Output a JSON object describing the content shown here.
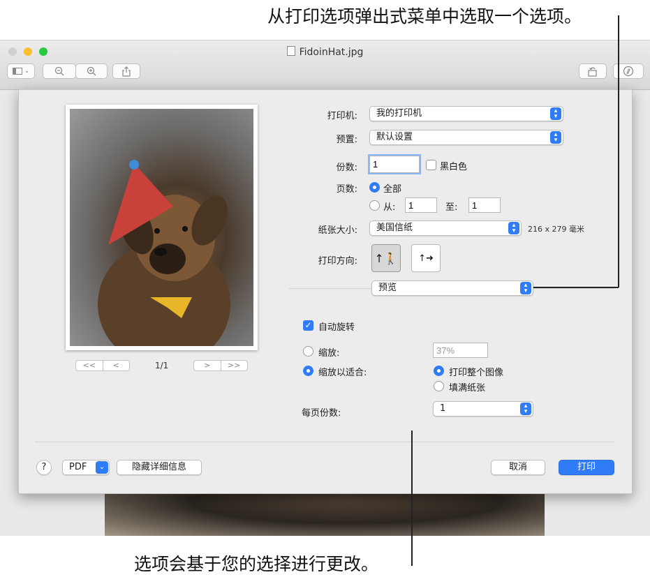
{
  "callouts": {
    "top": "从打印选项弹出式菜单中选取一个选项。",
    "bottom": "选项会基于您的选择进行更改。"
  },
  "window": {
    "title": "FidoinHat.jpg",
    "file_icon": "jpg-file-icon",
    "toolbar_icons": [
      "sidebar-icon",
      "chevron-down-icon",
      "zoom-out-icon",
      "zoom-in-icon",
      "share-icon",
      "rotate-icon",
      "markup-icon"
    ]
  },
  "preview": {
    "page_indicator": "1/1",
    "nav": {
      "first": "<<",
      "prev": "<",
      "next": ">",
      "last": ">>"
    }
  },
  "print": {
    "printer_label": "打印机:",
    "printer_value": "我的打印机",
    "presets_label": "预置:",
    "presets_value": "默认设置",
    "copies_label": "份数:",
    "copies_value": "1",
    "bw_label": "黑白色",
    "bw_checked": false,
    "pages_label": "页数:",
    "pages_all": "全部",
    "pages_from": "从:",
    "pages_from_value": "1",
    "pages_to": "至:",
    "pages_to_value": "1",
    "paper_label": "纸张大小:",
    "paper_value": "美国信纸",
    "paper_dims": "216 x 279 毫米",
    "orientation_label": "打印方向:",
    "section_value": "预览",
    "auto_rotate": "自动旋转",
    "auto_rotate_checked": true,
    "scale_label": "缩放:",
    "scale_value": "37%",
    "scale_to_fit": "缩放以适合:",
    "print_entire": "打印整个图像",
    "fill_paper": "填满纸张",
    "copies_per_page_label": "每页份数:",
    "copies_per_page_value": "1",
    "help": "?",
    "pdf": "PDF",
    "hide_details": "隐藏详细信息",
    "cancel": "取消",
    "print_btn": "打印"
  },
  "colors": {
    "accent": "#2f7cf6",
    "close": "#fe5f57",
    "minimize": "#febc2e",
    "zoom": "#28c840"
  }
}
